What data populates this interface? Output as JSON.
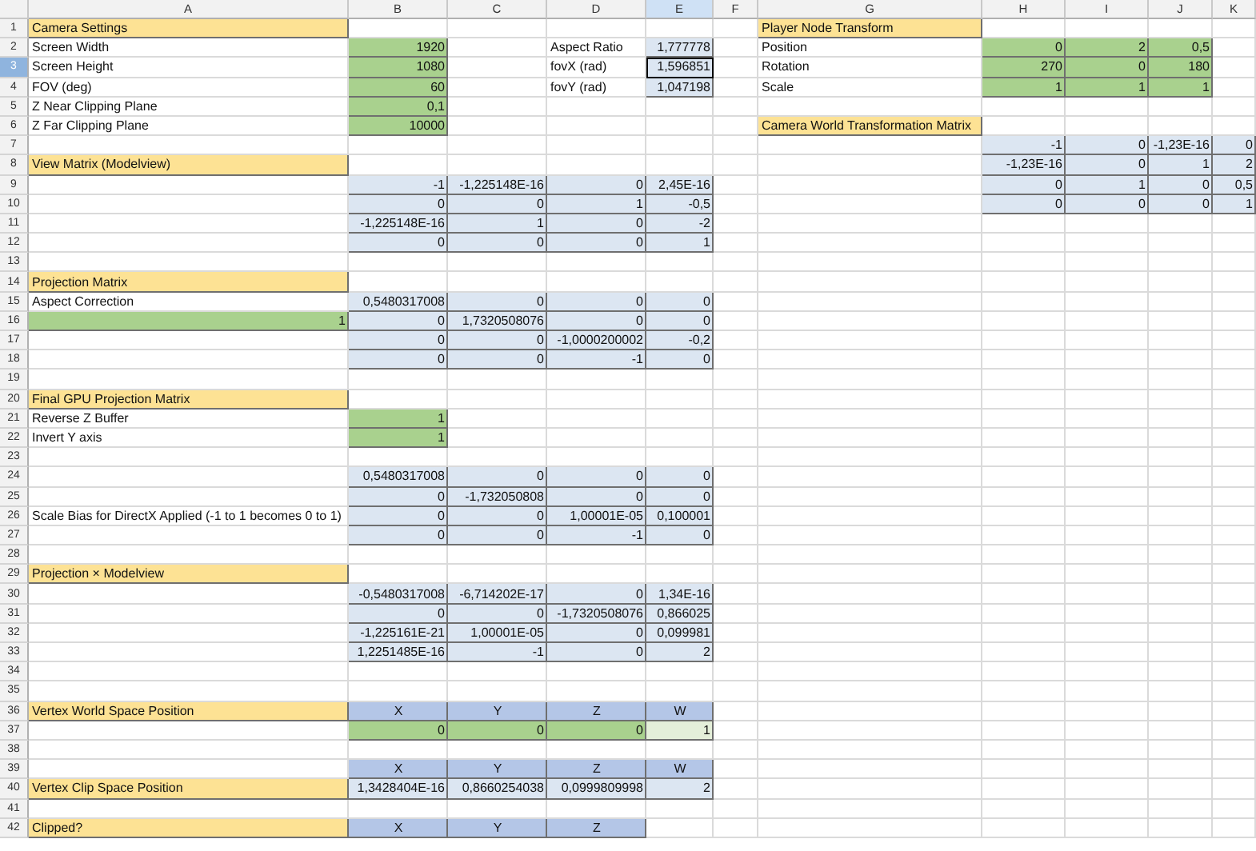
{
  "columns": [
    {
      "label": "A",
      "selected": false
    },
    {
      "label": "B",
      "selected": false
    },
    {
      "label": "C",
      "selected": false
    },
    {
      "label": "D",
      "selected": false
    },
    {
      "label": "E",
      "selected": true
    },
    {
      "label": "F",
      "selected": false
    },
    {
      "label": "G",
      "selected": false
    },
    {
      "label": "H",
      "selected": false
    },
    {
      "label": "I",
      "selected": false
    },
    {
      "label": "J",
      "selected": false
    },
    {
      "label": "K",
      "selected": false
    }
  ],
  "rows": [
    {
      "number": "1",
      "selected": false,
      "cells": [
        {
          "text": "Camera Settings",
          "kind": "title"
        },
        null,
        null,
        null,
        null,
        null,
        {
          "text": "Player Node Transform",
          "kind": "title"
        }
      ]
    },
    {
      "number": "2",
      "selected": false,
      "cells": [
        {
          "text": "Screen Width",
          "kind": "label"
        },
        {
          "text": "1920",
          "kind": "input"
        },
        null,
        {
          "text": "Aspect Ratio",
          "kind": "label"
        },
        {
          "text": "1,777778",
          "kind": "value"
        },
        null,
        {
          "text": "Position",
          "kind": "label"
        },
        {
          "text": "0",
          "kind": "input"
        },
        {
          "text": "2",
          "kind": "input"
        },
        {
          "text": "0,5",
          "kind": "input"
        }
      ]
    },
    {
      "number": "3",
      "selected": true,
      "cells": [
        {
          "text": "Screen Height",
          "kind": "label"
        },
        {
          "text": "1080",
          "kind": "input"
        },
        null,
        {
          "text": "fovX (rad)",
          "kind": "label"
        },
        {
          "text": "1,596851",
          "kind": "value"
        },
        null,
        {
          "text": "Rotation",
          "kind": "label"
        },
        {
          "text": "270",
          "kind": "input"
        },
        {
          "text": "0",
          "kind": "input"
        },
        {
          "text": "180",
          "kind": "input"
        }
      ]
    },
    {
      "number": "4",
      "selected": false,
      "cells": [
        {
          "text": "FOV (deg)",
          "kind": "label"
        },
        {
          "text": "60",
          "kind": "input"
        },
        null,
        {
          "text": "fovY (rad)",
          "kind": "label"
        },
        {
          "text": "1,047198",
          "kind": "value"
        },
        null,
        {
          "text": "Scale",
          "kind": "label"
        },
        {
          "text": "1",
          "kind": "input"
        },
        {
          "text": "1",
          "kind": "input"
        },
        {
          "text": "1",
          "kind": "input"
        }
      ]
    },
    {
      "number": "5",
      "selected": false,
      "cells": [
        {
          "text": "Z Near Clipping Plane",
          "kind": "label"
        },
        {
          "text": "0,1",
          "kind": "input"
        }
      ]
    },
    {
      "number": "6",
      "selected": false,
      "cells": [
        {
          "text": "Z Far Clipping Plane",
          "kind": "label"
        },
        {
          "text": "10000",
          "kind": "input"
        },
        null,
        null,
        null,
        null,
        {
          "text": "Camera World Transformation Matrix",
          "kind": "title"
        }
      ]
    },
    {
      "number": "7",
      "selected": false,
      "cells": [
        null,
        null,
        null,
        null,
        null,
        null,
        null,
        {
          "text": "-1",
          "kind": "value"
        },
        {
          "text": "0",
          "kind": "value"
        },
        {
          "text": "-1,23E-16",
          "kind": "value"
        },
        {
          "text": "0",
          "kind": "value"
        }
      ]
    },
    {
      "number": "8",
      "selected": false,
      "cells": [
        {
          "text": "View Matrix (Modelview)",
          "kind": "title"
        },
        null,
        null,
        null,
        null,
        null,
        null,
        {
          "text": "-1,23E-16",
          "kind": "value"
        },
        {
          "text": "0",
          "kind": "value"
        },
        {
          "text": "1",
          "kind": "value"
        },
        {
          "text": "2",
          "kind": "value"
        }
      ]
    },
    {
      "number": "9",
      "selected": false,
      "cells": [
        null,
        {
          "text": "-1",
          "kind": "value"
        },
        {
          "text": "-1,225148E-16",
          "kind": "value"
        },
        {
          "text": "0",
          "kind": "value"
        },
        {
          "text": "2,45E-16",
          "kind": "value"
        },
        null,
        null,
        {
          "text": "0",
          "kind": "value"
        },
        {
          "text": "1",
          "kind": "value"
        },
        {
          "text": "0",
          "kind": "value"
        },
        {
          "text": "0,5",
          "kind": "value"
        }
      ]
    },
    {
      "number": "10",
      "selected": false,
      "cells": [
        null,
        {
          "text": "0",
          "kind": "value"
        },
        {
          "text": "0",
          "kind": "value"
        },
        {
          "text": "1",
          "kind": "value"
        },
        {
          "text": "-0,5",
          "kind": "value"
        },
        null,
        null,
        {
          "text": "0",
          "kind": "value"
        },
        {
          "text": "0",
          "kind": "value"
        },
        {
          "text": "0",
          "kind": "value"
        },
        {
          "text": "1",
          "kind": "value"
        }
      ]
    },
    {
      "number": "11",
      "selected": false,
      "cells": [
        null,
        {
          "text": "-1,225148E-16",
          "kind": "value"
        },
        {
          "text": "1",
          "kind": "value"
        },
        {
          "text": "0",
          "kind": "value"
        },
        {
          "text": "-2",
          "kind": "value"
        }
      ]
    },
    {
      "number": "12",
      "selected": false,
      "cells": [
        null,
        {
          "text": "0",
          "kind": "value"
        },
        {
          "text": "0",
          "kind": "value"
        },
        {
          "text": "0",
          "kind": "value"
        },
        {
          "text": "1",
          "kind": "value"
        }
      ]
    },
    {
      "number": "13",
      "selected": false
    },
    {
      "number": "14",
      "selected": false,
      "cells": [
        {
          "text": "Projection Matrix",
          "kind": "title"
        }
      ]
    },
    {
      "number": "15",
      "selected": false,
      "cells": [
        {
          "text": "Aspect Correction",
          "kind": "label"
        },
        {
          "text": "0,5480317008",
          "kind": "value"
        },
        {
          "text": "0",
          "kind": "value"
        },
        {
          "text": "0",
          "kind": "value"
        },
        {
          "text": "0",
          "kind": "value"
        }
      ]
    },
    {
      "number": "16",
      "selected": false,
      "cells": [
        {
          "text": "1",
          "kind": "input"
        },
        {
          "text": "0",
          "kind": "value"
        },
        {
          "text": "1,7320508076",
          "kind": "value"
        },
        {
          "text": "0",
          "kind": "value"
        },
        {
          "text": "0",
          "kind": "value"
        }
      ]
    },
    {
      "number": "17",
      "selected": false,
      "cells": [
        null,
        {
          "text": "0",
          "kind": "value"
        },
        {
          "text": "0",
          "kind": "value"
        },
        {
          "text": "-1,0000200002",
          "kind": "value"
        },
        {
          "text": "-0,2",
          "kind": "value"
        }
      ]
    },
    {
      "number": "18",
      "selected": false,
      "cells": [
        null,
        {
          "text": "0",
          "kind": "value"
        },
        {
          "text": "0",
          "kind": "value"
        },
        {
          "text": "-1",
          "kind": "value"
        },
        {
          "text": "0",
          "kind": "value"
        }
      ]
    },
    {
      "number": "19",
      "selected": false
    },
    {
      "number": "20",
      "selected": false,
      "cells": [
        {
          "text": "Final GPU Projection Matrix",
          "kind": "title"
        }
      ]
    },
    {
      "number": "21",
      "selected": false,
      "cells": [
        {
          "text": "Reverse Z Buffer",
          "kind": "label"
        },
        {
          "text": "1",
          "kind": "input"
        }
      ]
    },
    {
      "number": "22",
      "selected": false,
      "cells": [
        {
          "text": "Invert Y axis",
          "kind": "label"
        },
        {
          "text": "1",
          "kind": "input"
        }
      ]
    },
    {
      "number": "23",
      "selected": false
    },
    {
      "number": "24",
      "selected": false,
      "cells": [
        null,
        {
          "text": "0,5480317008",
          "kind": "value"
        },
        {
          "text": "0",
          "kind": "value"
        },
        {
          "text": "0",
          "kind": "value"
        },
        {
          "text": "0",
          "kind": "value"
        }
      ]
    },
    {
      "number": "25",
      "selected": false,
      "cells": [
        null,
        {
          "text": "0",
          "kind": "value"
        },
        {
          "text": "-1,732050808",
          "kind": "value"
        },
        {
          "text": "0",
          "kind": "value"
        },
        {
          "text": "0",
          "kind": "value"
        }
      ]
    },
    {
      "number": "26",
      "selected": false,
      "cells": [
        {
          "text": "Scale Bias for DirectX Applied (-1 to 1 becomes 0 to 1)",
          "kind": "label"
        },
        {
          "text": "0",
          "kind": "value"
        },
        {
          "text": "0",
          "kind": "value"
        },
        {
          "text": "1,00001E-05",
          "kind": "value"
        },
        {
          "text": "0,100001",
          "kind": "value"
        }
      ]
    },
    {
      "number": "27",
      "selected": false,
      "cells": [
        null,
        {
          "text": "0",
          "kind": "value"
        },
        {
          "text": "0",
          "kind": "value"
        },
        {
          "text": "-1",
          "kind": "value"
        },
        {
          "text": "0",
          "kind": "value"
        }
      ]
    },
    {
      "number": "28",
      "selected": false
    },
    {
      "number": "29",
      "selected": false,
      "cells": [
        {
          "text": "Projection × Modelview",
          "kind": "title"
        }
      ]
    },
    {
      "number": "30",
      "selected": false,
      "cells": [
        null,
        {
          "text": "-0,5480317008",
          "kind": "value"
        },
        {
          "text": "-6,714202E-17",
          "kind": "value"
        },
        {
          "text": "0",
          "kind": "value"
        },
        {
          "text": "1,34E-16",
          "kind": "value"
        }
      ]
    },
    {
      "number": "31",
      "selected": false,
      "cells": [
        null,
        {
          "text": "0",
          "kind": "value"
        },
        {
          "text": "0",
          "kind": "value"
        },
        {
          "text": "-1,7320508076",
          "kind": "value"
        },
        {
          "text": "0,866025",
          "kind": "value"
        }
      ]
    },
    {
      "number": "32",
      "selected": false,
      "cells": [
        null,
        {
          "text": "-1,225161E-21",
          "kind": "value"
        },
        {
          "text": "1,00001E-05",
          "kind": "value"
        },
        {
          "text": "0",
          "kind": "value"
        },
        {
          "text": "0,099981",
          "kind": "value"
        }
      ]
    },
    {
      "number": "33",
      "selected": false,
      "cells": [
        null,
        {
          "text": "1,2251485E-16",
          "kind": "value"
        },
        {
          "text": "-1",
          "kind": "value"
        },
        {
          "text": "0",
          "kind": "value"
        },
        {
          "text": "2",
          "kind": "value"
        }
      ]
    },
    {
      "number": "34",
      "selected": false
    },
    {
      "number": "35",
      "selected": false
    },
    {
      "number": "36",
      "selected": false,
      "cells": [
        {
          "text": "Vertex World Space Position",
          "kind": "title"
        },
        {
          "text": "X",
          "kind": "axis"
        },
        {
          "text": "Y",
          "kind": "axis"
        },
        {
          "text": "Z",
          "kind": "axis"
        },
        {
          "text": "W",
          "kind": "axis"
        }
      ]
    },
    {
      "number": "37",
      "selected": false,
      "cells": [
        null,
        {
          "text": "0",
          "kind": "input"
        },
        {
          "text": "0",
          "kind": "input"
        },
        {
          "text": "0",
          "kind": "input"
        },
        {
          "text": "1",
          "kind": "pale"
        }
      ]
    },
    {
      "number": "38",
      "selected": false
    },
    {
      "number": "39",
      "selected": false,
      "cells": [
        null,
        {
          "text": "X",
          "kind": "axis"
        },
        {
          "text": "Y",
          "kind": "axis"
        },
        {
          "text": "Z",
          "kind": "axis"
        },
        {
          "text": "W",
          "kind": "axis"
        }
      ]
    },
    {
      "number": "40",
      "selected": false,
      "cells": [
        {
          "text": "Vertex Clip Space Position",
          "kind": "title"
        },
        {
          "text": "1,3428404E-16",
          "kind": "value"
        },
        {
          "text": "0,8660254038",
          "kind": "value"
        },
        {
          "text": "0,0999809998",
          "kind": "value"
        },
        {
          "text": "2",
          "kind": "value"
        }
      ]
    },
    {
      "number": "41",
      "selected": false
    },
    {
      "number": "42",
      "selected": false,
      "cells": [
        {
          "text": "Clipped?",
          "kind": "title"
        },
        {
          "text": "X",
          "kind": "axis"
        },
        {
          "text": "Y",
          "kind": "axis"
        },
        {
          "text": "Z",
          "kind": "axis"
        }
      ]
    }
  ]
}
